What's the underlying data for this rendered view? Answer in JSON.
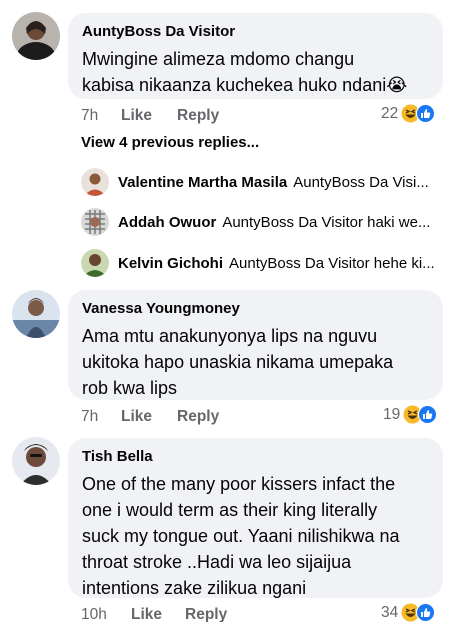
{
  "comments": [
    {
      "author": "AuntyBoss Da Visitor",
      "lines": [
        "Mwingine alimeza mdomo changu",
        "kabisa nikaanza kuchekea huko ndani😭"
      ],
      "time": "7h",
      "like": "Like",
      "reply": "Reply",
      "reaction_count": "22",
      "reactions": [
        "haha",
        "like"
      ]
    },
    {
      "author": "Vanessa Youngmoney",
      "lines": [
        "Ama mtu anakunyonya lips na nguvu",
        "ukitoka hapo unaskia nikama umepaka",
        "rob kwa lips"
      ],
      "time": "7h",
      "like": "Like",
      "reply": "Reply",
      "reaction_count": "19",
      "reactions": [
        "haha",
        "like"
      ]
    },
    {
      "author": "Tish Bella",
      "lines": [
        "One of the many poor kissers infact the",
        "one i would term as their king literally",
        "suck my tongue out. Yaani nilishikwa na",
        "throat stroke ..Hadi wa leo sijaijua",
        "intentions zake zilikua ngani"
      ],
      "time": "10h",
      "like": "Like",
      "reply": "Reply",
      "reaction_count": "34",
      "reactions": [
        "haha",
        "like"
      ]
    }
  ],
  "view_previous": "View 4 previous replies...",
  "replies": [
    {
      "name": "Valentine Martha Masila",
      "snippet": "AuntyBoss Da Visi..."
    },
    {
      "name": "Addah Owuor",
      "snippet": "AuntyBoss Da Visitor haki we..."
    },
    {
      "name": "Kelvin Gichohi",
      "snippet": "AuntyBoss Da Visitor hehe ki..."
    }
  ],
  "colors": {
    "bubble": "#f0f2f5",
    "meta_text": "#65676b",
    "like_blue": "#1877f2",
    "haha_yellow": "#f7b928"
  }
}
